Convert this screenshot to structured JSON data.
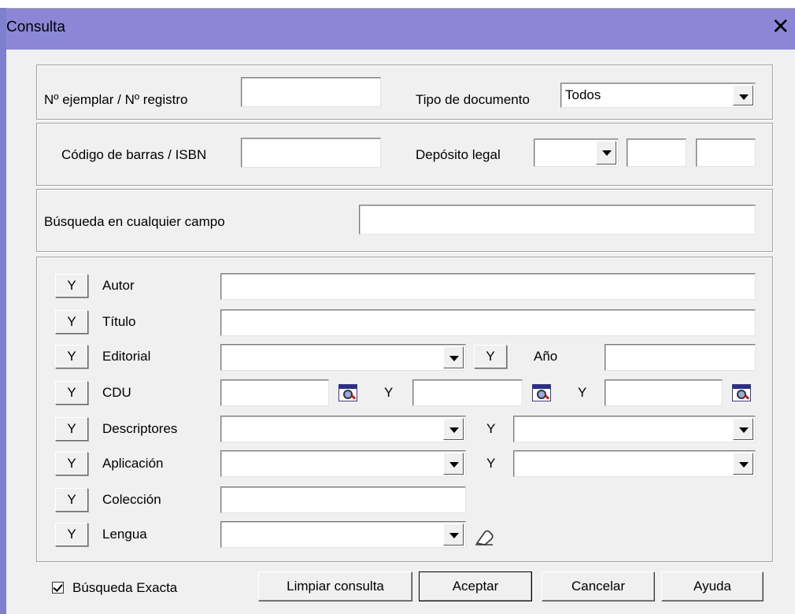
{
  "window": {
    "title": "Consulta",
    "close_icon": "close-icon"
  },
  "fields": {
    "ejemplar_label": "Nº ejemplar / Nº registro",
    "ejemplar_value": "",
    "tipo_label": "Tipo de documento",
    "tipo_value": "Todos",
    "codigo_label": "Código de barras / ISBN",
    "codigo_value": "",
    "deposito_label": "Depósito legal",
    "busqueda_label": "Búsqueda en cualquier campo",
    "busqueda_value": ""
  },
  "criteria": {
    "y": "Y",
    "autor": "Autor",
    "titulo": "Título",
    "editorial": "Editorial",
    "anio": "Año",
    "cdu": "CDU",
    "descriptores": "Descriptores",
    "aplicacion": "Aplicación",
    "coleccion": "Colección",
    "lengua": "Lengua"
  },
  "footer": {
    "exacta_label": "Búsqueda Exacta",
    "exacta_checked": true,
    "limpiar": "Limpiar consulta",
    "aceptar": "Aceptar",
    "cancelar": "Cancelar",
    "ayuda": "Ayuda"
  }
}
